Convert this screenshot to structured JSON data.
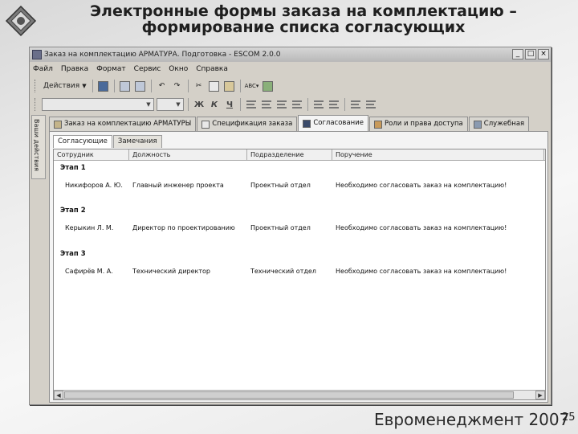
{
  "slide": {
    "title_line1": "Электронные формы заказа на комплектацию –",
    "title_line2": "формирование списка согласующих",
    "footer_brand": "Евроменеджмент 2007",
    "page_number": "25"
  },
  "window": {
    "title": "Заказ на комплектацию АРМАТУРА. Подготовка - ESCOM 2.0.0",
    "controls": [
      "_",
      "□",
      "×"
    ]
  },
  "menu": [
    "Файл",
    "Правка",
    "Формат",
    "Сервис",
    "Окно",
    "Справка"
  ],
  "toolbar": {
    "actions_label": "Действия",
    "icons": [
      "save-icon",
      "print-icon",
      "preview-icon",
      "undo-icon",
      "redo-icon",
      "cut-icon",
      "copy-icon",
      "paste-icon",
      "spellcheck-icon",
      "refresh-icon"
    ],
    "format_buttons": [
      "Ж",
      "К",
      "Ч"
    ]
  },
  "side_panel": {
    "label": "Ваши действия"
  },
  "tabs": [
    {
      "label": "Заказ на комплектацию АРМАТУРЫ",
      "active": false
    },
    {
      "label": "Спецификация заказа",
      "active": false
    },
    {
      "label": "Согласование",
      "active": true
    },
    {
      "label": "Роли и права доступа",
      "active": false
    },
    {
      "label": "Служебная",
      "active": false
    }
  ],
  "subtabs": [
    {
      "label": "Согласующие",
      "active": true
    },
    {
      "label": "Замечания",
      "active": false
    }
  ],
  "table": {
    "columns": [
      "Сотрудник",
      "Должность",
      "Подразделение",
      "Поручение"
    ],
    "groups": [
      {
        "label": "Этап 1",
        "rows": [
          [
            "Никифоров А. Ю.",
            "Главный инженер проекта",
            "Проектный отдел",
            "Необходимо согласовать заказ на комплектацию!"
          ]
        ]
      },
      {
        "label": "Этап 2",
        "rows": [
          [
            "Керыкин Л. М.",
            "Директор по проектированию",
            "Проектный отдел",
            "Необходимо согласовать заказ на комплектацию!"
          ]
        ]
      },
      {
        "label": "Этап 3",
        "rows": [
          [
            "Сафирёв М. А.",
            "Технический директор",
            "Технический отдел",
            "Необходимо согласовать заказ на комплектацию!"
          ]
        ]
      }
    ]
  }
}
